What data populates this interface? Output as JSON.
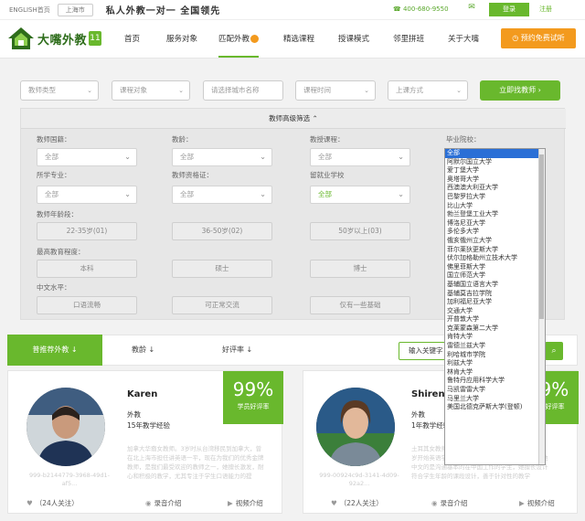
{
  "topbar": {
    "lang": "ENGLISH首页",
    "city": "上海市",
    "slogan": "私人外教一对一   全国领先",
    "phone": "400-680-9550",
    "login": "登录",
    "register": "注册"
  },
  "logo": {
    "name": "大嘴外教",
    "badge": "11"
  },
  "nav": {
    "items": [
      "首页",
      "服务对象",
      "匹配外教",
      "精选课程",
      "授课模式",
      "邻里拼班",
      "关于大嘴"
    ],
    "trial": "预约免费试听"
  },
  "search": {
    "teacher_type": "教师类型",
    "course_target": "课程对象",
    "city_placeholder": "请选择城市名称",
    "class_time": "课程时间",
    "class_mode": "上课方式",
    "find_button": "立即找教师"
  },
  "advanced": {
    "header": "教师高级筛选",
    "nationality_label": "教师国籍：",
    "nationality_value": "全部",
    "age_label": "教龄：",
    "age_value": "全部",
    "subject_label": "教授课程：",
    "subject_value": "全部",
    "school_label": "毕业院校：",
    "major_label": "所学专业：",
    "major_value": "全部",
    "cert_label": "教师资格证：",
    "cert_value": "全部",
    "alma_label": "留就业学校",
    "alma_value": "全部",
    "agegroup_label": "教师年龄段：",
    "agegroups": [
      "22-35岁(01)",
      "36-50岁(02)",
      "50岁以上(03)"
    ],
    "edu_label": "最高教育程度：",
    "edu_levels": [
      "本科",
      "硕士",
      "博士"
    ],
    "chinese_label": "中文水平：",
    "chinese_levels": [
      "口语流畅",
      "可正常交流",
      "仅有一些基础"
    ]
  },
  "schools": [
    "全部",
    "阿默尔国立大学",
    "爱丁堡大学",
    "奥塔哥大学",
    "西澳澳大利亚大学",
    "巴黎罗拉大学",
    "比山大学",
    "勃兰登堡工业大学",
    "博洛尼亚大学",
    "多伦多大学",
    "俄亥俄州立大学",
    "菲尔莱狄更斯大学",
    "伏尔加格勒州立技术大学",
    "佛里菲斯大学",
    "国立师范大学",
    "基辅国立语言大学",
    "基辅莫吉拉学院",
    "加利福尼亚大学",
    "交通大学",
    "开普敦大学",
    "克莱蒙森第二大学",
    "肯特大学",
    "雷德兰兹大学",
    "利哈城市学院",
    "利兹大学",
    "林肯大学",
    "鲁特丹应用科学大学",
    "马凯雷雷大学",
    "马里兰大学",
    "美国北德克萨斯大学(登顿)"
  ],
  "sort": {
    "recommend": "普推荐外教",
    "teaching_age": "教龄",
    "good_rate": "好评率",
    "keyword_placeholder": "输入关键字"
  },
  "teachers": [
    {
      "name": "Karen",
      "type": "外教",
      "experience": "15年教学经验",
      "rate": "99%",
      "rate_label": "学员好评率",
      "desc": "加拿大华裔女教师。3岁时从台湾移民到加拿大，曾在北上海市担任讲英语一平，现在为我们的优秀金牌教师，是我们最受欢迎的教师之一，她擅长激发，耐心和积极的教学，尤其专注于学生口语能力的提",
      "code": "999-b2144779-3968-49d1-af5...",
      "follow": "（24人关注）",
      "audio": "录音介绍",
      "video": "视频介绍"
    },
    {
      "name": "Shiren",
      "type": "外教",
      "experience": "1年教学经验",
      "rate": "99%",
      "rate_label": "学员好评率",
      "desc": "土耳其女教师，的大学2岁时候到达新西兰学习，6岁开始英语学习在多国主要语。在上海的一年里面她中文的是沟通基本的在中国工作的学生，她擅长设计符合学生年龄的课段设计，善于针对性的教学",
      "code": "999-00924c9d-3141-4d09-92a2...",
      "follow": "（22人关注）",
      "audio": "录音介绍",
      "video": "视频介绍"
    }
  ],
  "colors": {
    "brand_green": "#69b82d",
    "accent_orange": "#f39a1e"
  }
}
